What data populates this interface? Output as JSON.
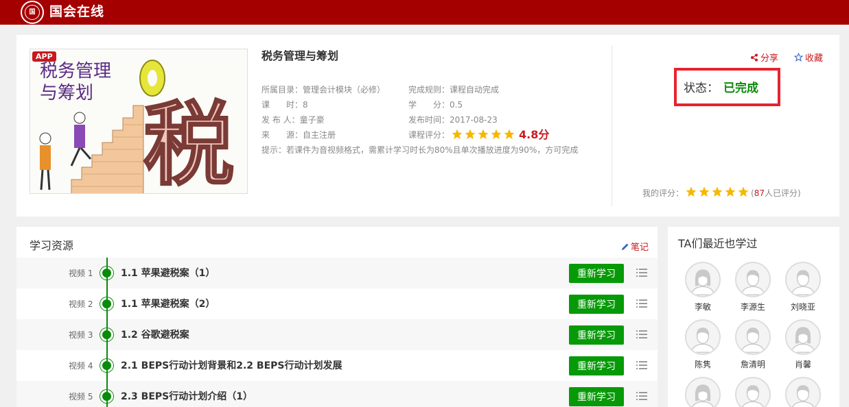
{
  "header": {
    "logo_text": "国会在线",
    "seal_text": "国"
  },
  "course": {
    "app_badge": "APP",
    "cover_text": [
      "税务管理",
      "与筹划",
      "税"
    ],
    "title": "税务管理与筹划",
    "meta": [
      {
        "label": "所属目录：",
        "value": "管理会计模块（必修）"
      },
      {
        "label": "完成规则：",
        "value": "课程自动完成"
      },
      {
        "label": "课　　时：",
        "value": "8"
      },
      {
        "label": "学　　分：",
        "value": "0.5"
      },
      {
        "label": "发 布 人：",
        "value": "童子豪"
      },
      {
        "label": "发布时间：",
        "value": "2017-08-23"
      },
      {
        "label": "来　　源：",
        "value": "自主注册"
      },
      {
        "label": "课程评分：",
        "value": ""
      }
    ],
    "course_rating": 5,
    "score": "4.8分",
    "hint": "提示：若课件为音视频格式，需累计学习时长为80%且单次播放进度为90%，方可完成",
    "share_label": "分享",
    "fav_label": "收藏",
    "status_label": "状态：",
    "status_value": "已完成",
    "my_rating_label": "我的评分：",
    "my_rating": 5,
    "rating_count_open": "(",
    "rating_count": "87",
    "rating_count_close": "人已评分)"
  },
  "resources": {
    "title": "学习资源",
    "notes_label": "笔记",
    "rows": [
      {
        "label": "视频 1",
        "name": "1.1 苹果避税案（1）",
        "button": "重新学习"
      },
      {
        "label": "视频 2",
        "name": "1.1 苹果避税案（2）",
        "button": "重新学习"
      },
      {
        "label": "视频 3",
        "name": "1.2 谷歌避税案",
        "button": "重新学习"
      },
      {
        "label": "视频 4",
        "name": "2.1 BEPS行动计划背景和2.2 BEPS行动计划发展",
        "button": "重新学习"
      },
      {
        "label": "视频 5",
        "name": "2.3 BEPS行动计划介绍（1）",
        "button": "重新学习"
      }
    ]
  },
  "ta_section": {
    "title": "TA们最近也学过",
    "users": [
      {
        "name": "李敏",
        "gender": "female"
      },
      {
        "name": "李源生",
        "gender": "male"
      },
      {
        "name": "刘晓亚",
        "gender": "male"
      },
      {
        "name": "陈隽",
        "gender": "male"
      },
      {
        "name": "詹清明",
        "gender": "male"
      },
      {
        "name": "肖馨",
        "gender": "female"
      },
      {
        "name": "",
        "gender": "female"
      },
      {
        "name": "",
        "gender": "male"
      },
      {
        "name": "",
        "gender": "male"
      }
    ]
  },
  "colors": {
    "brand": "#a50000",
    "accent": "#c8191e",
    "success": "#079a08",
    "star": "#f5b800"
  }
}
